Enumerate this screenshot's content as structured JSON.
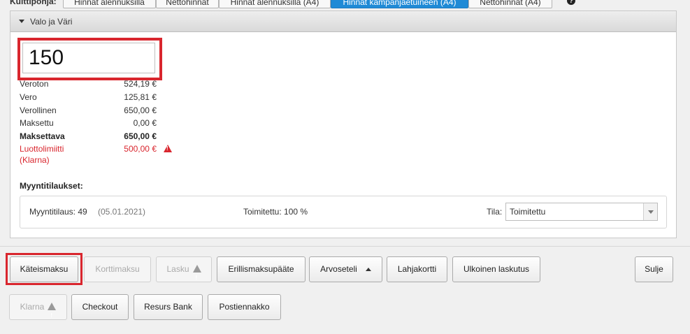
{
  "top": {
    "label": "Kuittipohja:",
    "tabs": [
      {
        "label": "Hinnat alennuksilla",
        "active": false
      },
      {
        "label": "Nettohinnat",
        "active": false
      },
      {
        "label": "Hinnat alennuksilla (A4)",
        "active": false
      },
      {
        "label": "Hinnat kampanjaetuineen (A4)",
        "active": true
      },
      {
        "label": "Nettohinnat (A4)",
        "active": false
      }
    ],
    "help_icon": "help-icon"
  },
  "panel": {
    "title": "Valo ja Väri",
    "amount_value": "150"
  },
  "summary": [
    {
      "label": "Veroton",
      "value": "524,19 €"
    },
    {
      "label": "Vero",
      "value": "125,81 €"
    },
    {
      "label": "Verollinen",
      "value": "650,00 €"
    },
    {
      "label": "Maksettu",
      "value": "0,00 €"
    },
    {
      "label": "Maksettava",
      "value": "650,00 €"
    },
    {
      "label": "Luottolimiitti",
      "label2": "(Klarna)",
      "value": "500,00 €"
    }
  ],
  "orders": {
    "title": "Myyntitilaukset:",
    "items": [
      {
        "order": "Myyntitilaus: 49",
        "date": "(05.01.2021)",
        "delivered": "Toimitettu: 100 %",
        "status_label": "Tila:",
        "status_value": "Toimitettu"
      }
    ]
  },
  "buttons": {
    "cash": "Käteismaksu",
    "card": "Korttimaksu",
    "invoice": "Lasku",
    "terminal": "Erillismaksupääte",
    "voucher": "Arvoseteli",
    "gift": "Lahjakortti",
    "external": "Ulkoinen laskutus",
    "close": "Sulje",
    "klarna": "Klarna",
    "checkout": "Checkout",
    "resurs": "Resurs Bank",
    "postal": "Postiennakko"
  },
  "colors": {
    "accent": "#1f8ad6",
    "highlight": "#d9262e",
    "error": "#d9262e"
  }
}
